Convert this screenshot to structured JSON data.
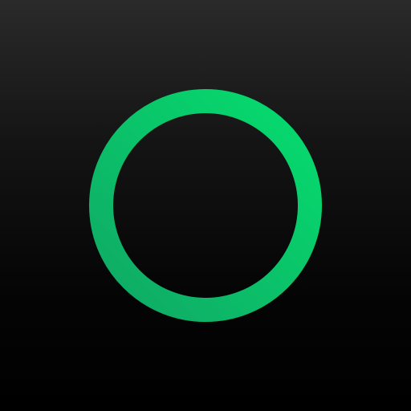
{
  "icon": {
    "name": "ring-icon",
    "background_top": "#2a2a2a",
    "background_bottom": "#000000",
    "ring_color_start": "#10a865",
    "ring_color_end": "#05dd6e"
  }
}
